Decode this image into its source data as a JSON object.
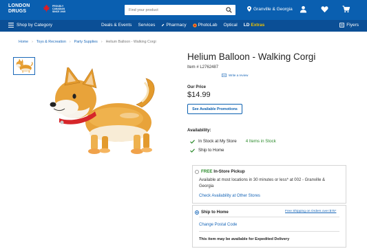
{
  "brand": {
    "logo_line1": "LONDON",
    "logo_line2": "DRUGS",
    "proud_line1": "PROUDLY",
    "proud_line2": "CANADIAN",
    "proud_line3": "SINCE 1945"
  },
  "search": {
    "placeholder": "Find your product"
  },
  "header": {
    "location": "Granville & Georgia"
  },
  "nav": {
    "shop_by_category": "Shop by Category",
    "items": [
      "Deals & Events",
      "Services",
      "Pharmacy",
      "PhotoLab",
      "Optical"
    ],
    "ld_prefix": "LD",
    "ld_suffix": "Extras",
    "flyers": "Flyers"
  },
  "breadcrumb": [
    "Home",
    "Toys & Recreation",
    "Party Supplies",
    "Helium Balloon - Walking Corgi"
  ],
  "product": {
    "title": "Helium Balloon - Walking Corgi",
    "item_number": "Item # L2762487",
    "write_review": "Write a review",
    "our_price_label": "Our Price",
    "price": "$14.99",
    "promotions_button": "See Available Promotions"
  },
  "availability": {
    "label": "Availability:",
    "in_stock_label": "In Stock at My Store",
    "in_stock_count": "4 Items in Stock",
    "ship_label": "Ship to Home"
  },
  "pickup": {
    "free_word": "FREE",
    "title_rest": "In-Store Pickup",
    "text_line1": "Available at most locations in 30 minutes or less* at 002 - Granville &",
    "text_line2": "Georgia",
    "check_link": "Check Availability at Other Stores"
  },
  "ship": {
    "title": "Ship to Home",
    "free_shipping_link": "Free Shipping on Orders over $75*",
    "postal_link": "Change Postal Code",
    "expedited_note": "This item may be available for Expedited Delivery"
  },
  "colors": {
    "header_blue": "#0a5fb0",
    "nav_blue": "#0b4f96",
    "link_blue": "#1967b8",
    "stock_green": "#2a8a2a",
    "extras_yellow": "#f2c300"
  },
  "icons": [
    "search-icon",
    "location-pin-icon",
    "user-icon",
    "heart-icon",
    "cart-icon",
    "menu-icon",
    "pharmacy-icon",
    "photolab-icon",
    "flyers-icon",
    "check-icon",
    "review-icon",
    "maple-leaf-icon"
  ]
}
